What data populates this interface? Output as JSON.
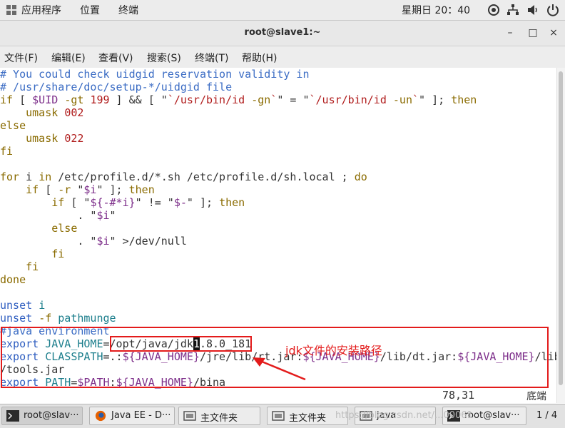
{
  "top_panel": {
    "apps_label": "应用程序",
    "places_label": "位置",
    "terminal_label": "终端",
    "clock": "星期日 20：40"
  },
  "window": {
    "title": "root@slave1:~",
    "min_symbol": "–",
    "max_symbol": "□",
    "close_symbol": "×"
  },
  "menu": {
    "file": "文件(F)",
    "edit": "编辑(E)",
    "view": "查看(V)",
    "search": "搜索(S)",
    "terminal": "终端(T)",
    "help": "帮助(H)"
  },
  "editor": {
    "status_pos": "78,31",
    "status_pct": "底端"
  },
  "annotation": {
    "label": "jdk文件的安装路径"
  },
  "taskbar": {
    "items": [
      {
        "label": "root@slav···"
      },
      {
        "label": "Java EE - D···"
      },
      {
        "label": "主文件夹"
      },
      {
        "label": "主文件夹"
      },
      {
        "label": "java"
      },
      {
        "label": "root@slav···"
      }
    ],
    "pager": "1 / 4",
    "watermark": "https://blog.csdn.net/...00061"
  },
  "colors": {
    "comment": "#3b6cc4",
    "keyword": "#8a6b00",
    "string_path": "#b01c1c",
    "annotation": "#e31b1b"
  }
}
